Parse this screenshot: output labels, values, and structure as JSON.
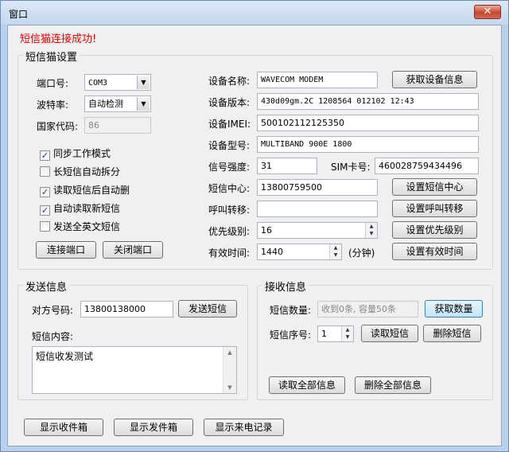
{
  "window": {
    "title": "窗口",
    "close_glyph": "✕"
  },
  "status": "短信猫连接成功!",
  "settings": {
    "title": "短信猫设置",
    "port_label": "端口号:",
    "port_value": "COM3",
    "baud_label": "波特率:",
    "baud_value": "自动检测",
    "country_label": "国家代码:",
    "country_value": "86",
    "checkboxes": [
      {
        "label": "同步工作模式",
        "checked": true
      },
      {
        "label": "长短信自动拆分",
        "checked": false
      },
      {
        "label": "读取短信后自动删",
        "checked": true
      },
      {
        "label": "自动读取新短信",
        "checked": true
      },
      {
        "label": "发送全英文短信",
        "checked": false
      }
    ],
    "connect_btn": "连接端口",
    "close_port_btn": "关闭端口",
    "device_name_label": "设备名称:",
    "device_name_value": "WAVECOM MODEM",
    "get_info_btn": "获取设备信息",
    "device_version_label": "设备版本:",
    "device_version_value": "430d09gm.2C 1208564 012102 12:43",
    "imei_label": "设备IMEI:",
    "imei_value": "500102112125350",
    "model_label": "设备型号:",
    "model_value": "MULTIBAND  900E  1800",
    "signal_label": "信号强度:",
    "signal_value": "31",
    "sim_label": "SIM卡号:",
    "sim_value": "460028759434496",
    "sms_center_label": "短信中心:",
    "sms_center_value": "13800759500",
    "set_center_btn": "设置短信中心",
    "forward_label": "呼叫转移:",
    "forward_value": "",
    "set_forward_btn": "设置呼叫转移",
    "priority_label": "优先级别:",
    "priority_value": "16",
    "set_priority_btn": "设置优先级别",
    "validity_label": "有效时间:",
    "validity_value": "1440",
    "validity_unit": "(分钟)",
    "set_validity_btn": "设置有效时间"
  },
  "send": {
    "title": "发送信息",
    "peer_label": "对方号码:",
    "peer_value": "13800138000",
    "send_btn": "发送短信",
    "content_label": "短信内容:",
    "content_value": "短信收发测试"
  },
  "receive": {
    "title": "接收信息",
    "count_label": "短信数量:",
    "count_value": "收到0条, 容量50条",
    "get_count_btn": "获取数量",
    "index_label": "短信序号:",
    "index_value": "1",
    "read_btn": "读取短信",
    "delete_btn": "删除短信",
    "read_all_btn": "读取全部信息",
    "delete_all_btn": "删除全部信息"
  },
  "footer": {
    "inbox_btn": "显示收件箱",
    "outbox_btn": "显示发件箱",
    "calls_btn": "显示来电记录"
  }
}
